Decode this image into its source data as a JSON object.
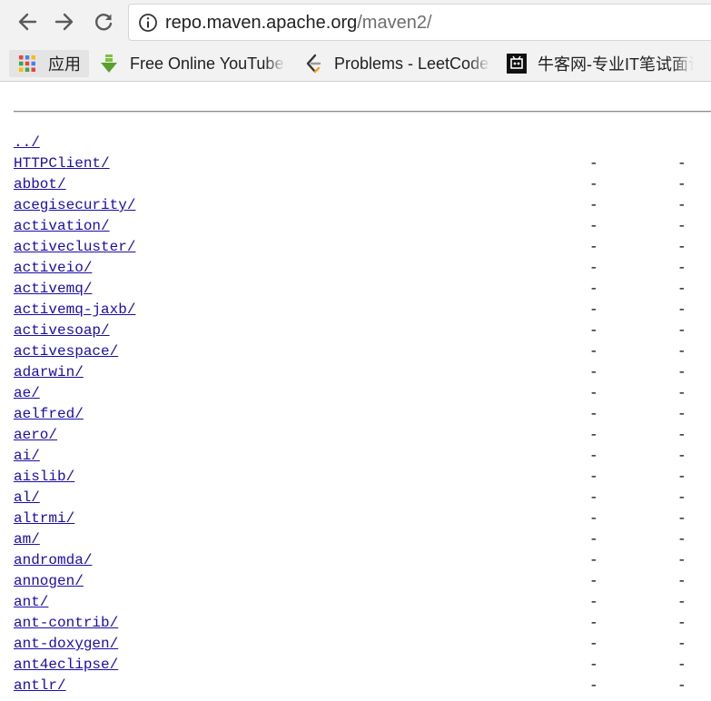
{
  "browser": {
    "url_host": "repo.maven.apache.org",
    "url_path": "/maven2/",
    "icons": {
      "back": "back-arrow-icon",
      "forward": "forward-arrow-icon",
      "reload": "reload-icon",
      "site_info": "info-icon"
    }
  },
  "bookmarks": [
    {
      "label": "应用",
      "icon": "apps-grid-icon"
    },
    {
      "label": "Free Online YouTube",
      "icon": "download-arrow-icon"
    },
    {
      "label": "Problems - LeetCode",
      "icon": "leetcode-icon"
    },
    {
      "label": "牛客网-专业IT笔试面试",
      "icon": "nowcoder-icon"
    }
  ],
  "listing": {
    "rows": [
      {
        "name": "../",
        "date": "",
        "size": ""
      },
      {
        "name": "HTTPClient/",
        "date": "-",
        "size": "-"
      },
      {
        "name": "abbot/",
        "date": "-",
        "size": "-"
      },
      {
        "name": "acegisecurity/",
        "date": "-",
        "size": "-"
      },
      {
        "name": "activation/",
        "date": "-",
        "size": "-"
      },
      {
        "name": "activecluster/",
        "date": "-",
        "size": "-"
      },
      {
        "name": "activeio/",
        "date": "-",
        "size": "-"
      },
      {
        "name": "activemq/",
        "date": "-",
        "size": "-"
      },
      {
        "name": "activemq-jaxb/",
        "date": "-",
        "size": "-"
      },
      {
        "name": "activesoap/",
        "date": "-",
        "size": "-"
      },
      {
        "name": "activespace/",
        "date": "-",
        "size": "-"
      },
      {
        "name": "adarwin/",
        "date": "-",
        "size": "-"
      },
      {
        "name": "ae/",
        "date": "-",
        "size": "-"
      },
      {
        "name": "aelfred/",
        "date": "-",
        "size": "-"
      },
      {
        "name": "aero/",
        "date": "-",
        "size": "-"
      },
      {
        "name": "ai/",
        "date": "-",
        "size": "-"
      },
      {
        "name": "aislib/",
        "date": "-",
        "size": "-"
      },
      {
        "name": "al/",
        "date": "-",
        "size": "-"
      },
      {
        "name": "altrmi/",
        "date": "-",
        "size": "-"
      },
      {
        "name": "am/",
        "date": "-",
        "size": "-"
      },
      {
        "name": "andromda/",
        "date": "-",
        "size": "-"
      },
      {
        "name": "annogen/",
        "date": "-",
        "size": "-"
      },
      {
        "name": "ant/",
        "date": "-",
        "size": "-"
      },
      {
        "name": "ant-contrib/",
        "date": "-",
        "size": "-"
      },
      {
        "name": "ant-doxygen/",
        "date": "-",
        "size": "-"
      },
      {
        "name": "ant4eclipse/",
        "date": "-",
        "size": "-"
      },
      {
        "name": "antlr/",
        "date": "-",
        "size": "-"
      }
    ]
  },
  "colors": {
    "link": "#1a0dab",
    "toolbar_bg": "#f2f2f2"
  }
}
